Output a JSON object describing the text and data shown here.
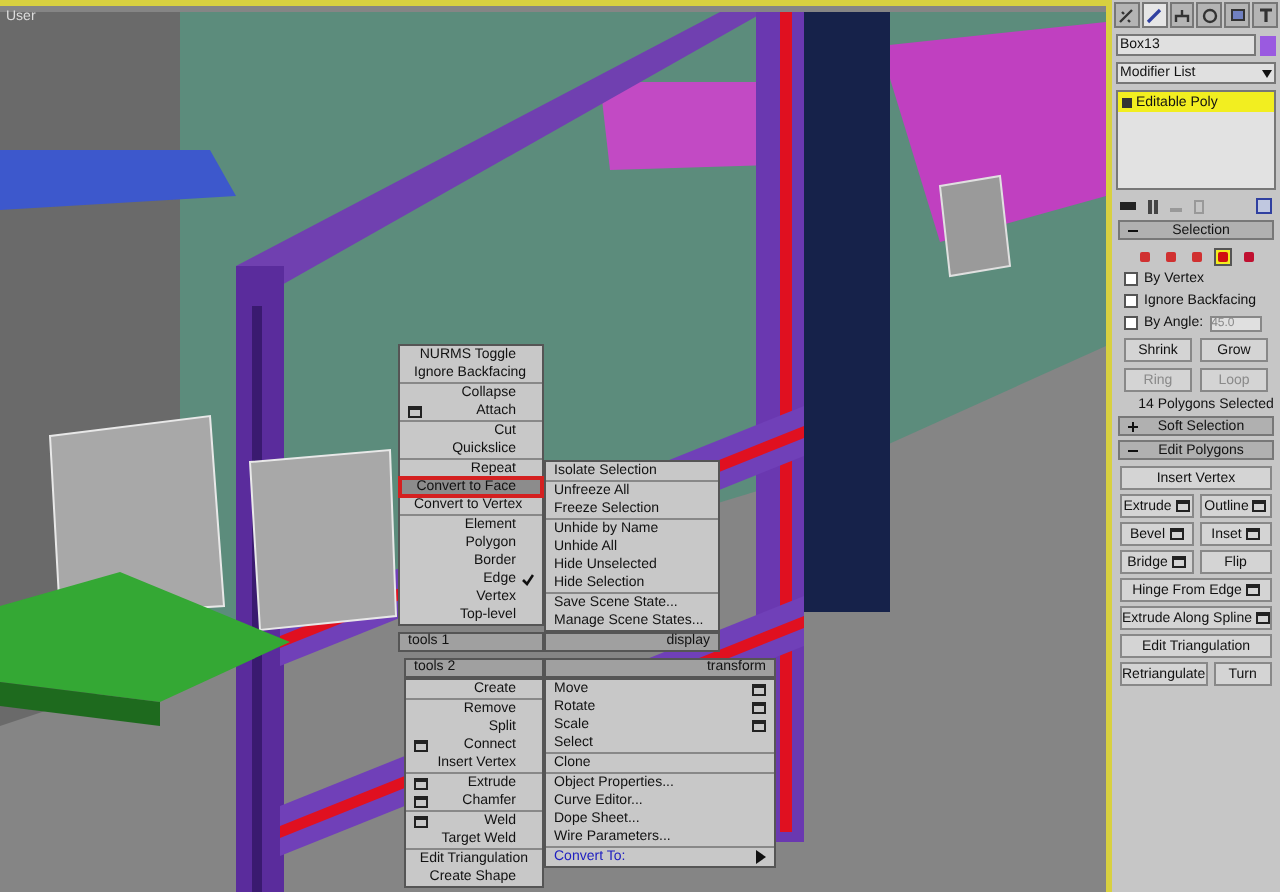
{
  "viewport": {
    "label": "User"
  },
  "quad_menu": {
    "tools_1": {
      "header": "tools 1",
      "groups": [
        [
          {
            "label": "NURMS Toggle",
            "settings": false,
            "selected": false,
            "checked": false
          },
          {
            "label": "Ignore Backfacing",
            "settings": false,
            "selected": false,
            "checked": false
          }
        ],
        [
          {
            "label": "Collapse",
            "settings": false,
            "selected": false,
            "checked": false
          },
          {
            "label": "Attach",
            "settings": true,
            "selected": false,
            "checked": false
          }
        ],
        [
          {
            "label": "Cut",
            "settings": false,
            "selected": false,
            "checked": false
          },
          {
            "label": "Quickslice",
            "settings": false,
            "selected": false,
            "checked": false
          }
        ],
        [
          {
            "label": "Repeat",
            "settings": false,
            "selected": false,
            "checked": false
          },
          {
            "label": "Convert to Face",
            "settings": false,
            "selected": true,
            "checked": false
          },
          {
            "label": "Convert to Vertex",
            "settings": false,
            "selected": false,
            "checked": false
          }
        ],
        [
          {
            "label": "Element",
            "settings": false,
            "selected": false,
            "checked": false
          },
          {
            "label": "Polygon",
            "settings": false,
            "selected": false,
            "checked": false
          },
          {
            "label": "Border",
            "settings": false,
            "selected": false,
            "checked": false
          },
          {
            "label": "Edge",
            "settings": false,
            "selected": false,
            "checked": true
          },
          {
            "label": "Vertex",
            "settings": false,
            "selected": false,
            "checked": false
          },
          {
            "label": "Top-level",
            "settings": false,
            "selected": false,
            "checked": false
          }
        ]
      ]
    },
    "display": {
      "header": "display",
      "groups": [
        [
          {
            "label": "Isolate Selection"
          }
        ],
        [
          {
            "label": "Unfreeze All"
          },
          {
            "label": "Freeze Selection"
          }
        ],
        [
          {
            "label": "Unhide by Name"
          },
          {
            "label": "Unhide All"
          },
          {
            "label": "Hide Unselected"
          },
          {
            "label": "Hide Selection"
          }
        ],
        [
          {
            "label": "Save Scene State..."
          },
          {
            "label": "Manage Scene States..."
          }
        ]
      ]
    },
    "tools_2": {
      "header": "tools 2",
      "groups": [
        [
          {
            "label": "Create",
            "settings": false
          }
        ],
        [
          {
            "label": "Remove",
            "settings": false
          },
          {
            "label": "Split",
            "settings": false
          },
          {
            "label": "Connect",
            "settings": true
          },
          {
            "label": "Insert Vertex",
            "settings": false
          }
        ],
        [
          {
            "label": "Extrude",
            "settings": true
          },
          {
            "label": "Chamfer",
            "settings": true
          }
        ],
        [
          {
            "label": "Weld",
            "settings": true
          },
          {
            "label": "Target Weld",
            "settings": false
          }
        ],
        [
          {
            "label": "Edit Triangulation",
            "settings": false
          },
          {
            "label": "Create Shape",
            "settings": false
          }
        ]
      ]
    },
    "transform": {
      "header": "transform",
      "groups": [
        [
          {
            "label": "Move",
            "settings": true,
            "submenu": false
          },
          {
            "label": "Rotate",
            "settings": true,
            "submenu": false
          },
          {
            "label": "Scale",
            "settings": true,
            "submenu": false
          },
          {
            "label": "Select",
            "settings": false,
            "submenu": false
          }
        ],
        [
          {
            "label": "Clone",
            "settings": false,
            "submenu": false
          }
        ],
        [
          {
            "label": "Object Properties...",
            "settings": false,
            "submenu": false
          },
          {
            "label": "Curve Editor...",
            "settings": false,
            "submenu": false
          },
          {
            "label": "Dope Sheet...",
            "settings": false,
            "submenu": false
          },
          {
            "label": "Wire Parameters...",
            "settings": false,
            "submenu": false
          }
        ],
        [
          {
            "label": "Convert To:",
            "settings": false,
            "submenu": true
          }
        ]
      ]
    }
  },
  "command_panel": {
    "tabs": [
      {
        "kind": "create",
        "selected": false
      },
      {
        "kind": "modify",
        "selected": true
      },
      {
        "kind": "hierarchy",
        "selected": false
      },
      {
        "kind": "motion",
        "selected": false
      },
      {
        "kind": "display",
        "selected": false
      },
      {
        "kind": "utilities",
        "selected": false
      }
    ],
    "object_name": "Box13",
    "modifier_list": "Modifier List",
    "stack": [
      {
        "label": "Editable Poly",
        "selected": true
      }
    ],
    "selection": {
      "title": "Selection",
      "expanded": true,
      "levels": [
        {
          "kind": "vertex",
          "selected": false
        },
        {
          "kind": "edge",
          "selected": false
        },
        {
          "kind": "border",
          "selected": false
        },
        {
          "kind": "polygon",
          "selected": true
        },
        {
          "kind": "element",
          "selected": false
        }
      ],
      "options": [
        {
          "label": "By Vertex",
          "checked": false
        },
        {
          "label": "Ignore Backfacing",
          "checked": false
        }
      ],
      "by_angle": {
        "label": "By Angle:",
        "checked": false,
        "value": "45.0"
      },
      "buttons": [
        {
          "label": "Shrink",
          "disabled": false
        },
        {
          "label": "Grow",
          "disabled": false
        },
        {
          "label": "Ring",
          "disabled": true
        },
        {
          "label": "Loop",
          "disabled": true
        }
      ],
      "status": "14 Polygons Selected"
    },
    "soft_selection": {
      "title": "Soft Selection",
      "expanded": false
    },
    "edit_polygons": {
      "title": "Edit Polygons",
      "expanded": true,
      "rows": [
        [
          {
            "label": "Insert Vertex",
            "settings": false
          }
        ],
        [
          {
            "label": "Extrude",
            "settings": true
          },
          {
            "label": "Outline",
            "settings": true
          }
        ],
        [
          {
            "label": "Bevel",
            "settings": true
          },
          {
            "label": "Inset",
            "settings": true
          }
        ],
        [
          {
            "label": "Bridge",
            "settings": true
          },
          {
            "label": "Flip",
            "settings": false
          }
        ],
        [
          {
            "label": "Hinge From Edge",
            "settings": true
          }
        ],
        [
          {
            "label": "Extrude Along Spline",
            "settings": true
          }
        ],
        [
          {
            "label": "Edit Triangulation",
            "settings": false
          }
        ],
        [
          {
            "label": "Retriangulate",
            "settings": false
          },
          {
            "label": "Turn",
            "settings": false
          }
        ]
      ]
    }
  }
}
